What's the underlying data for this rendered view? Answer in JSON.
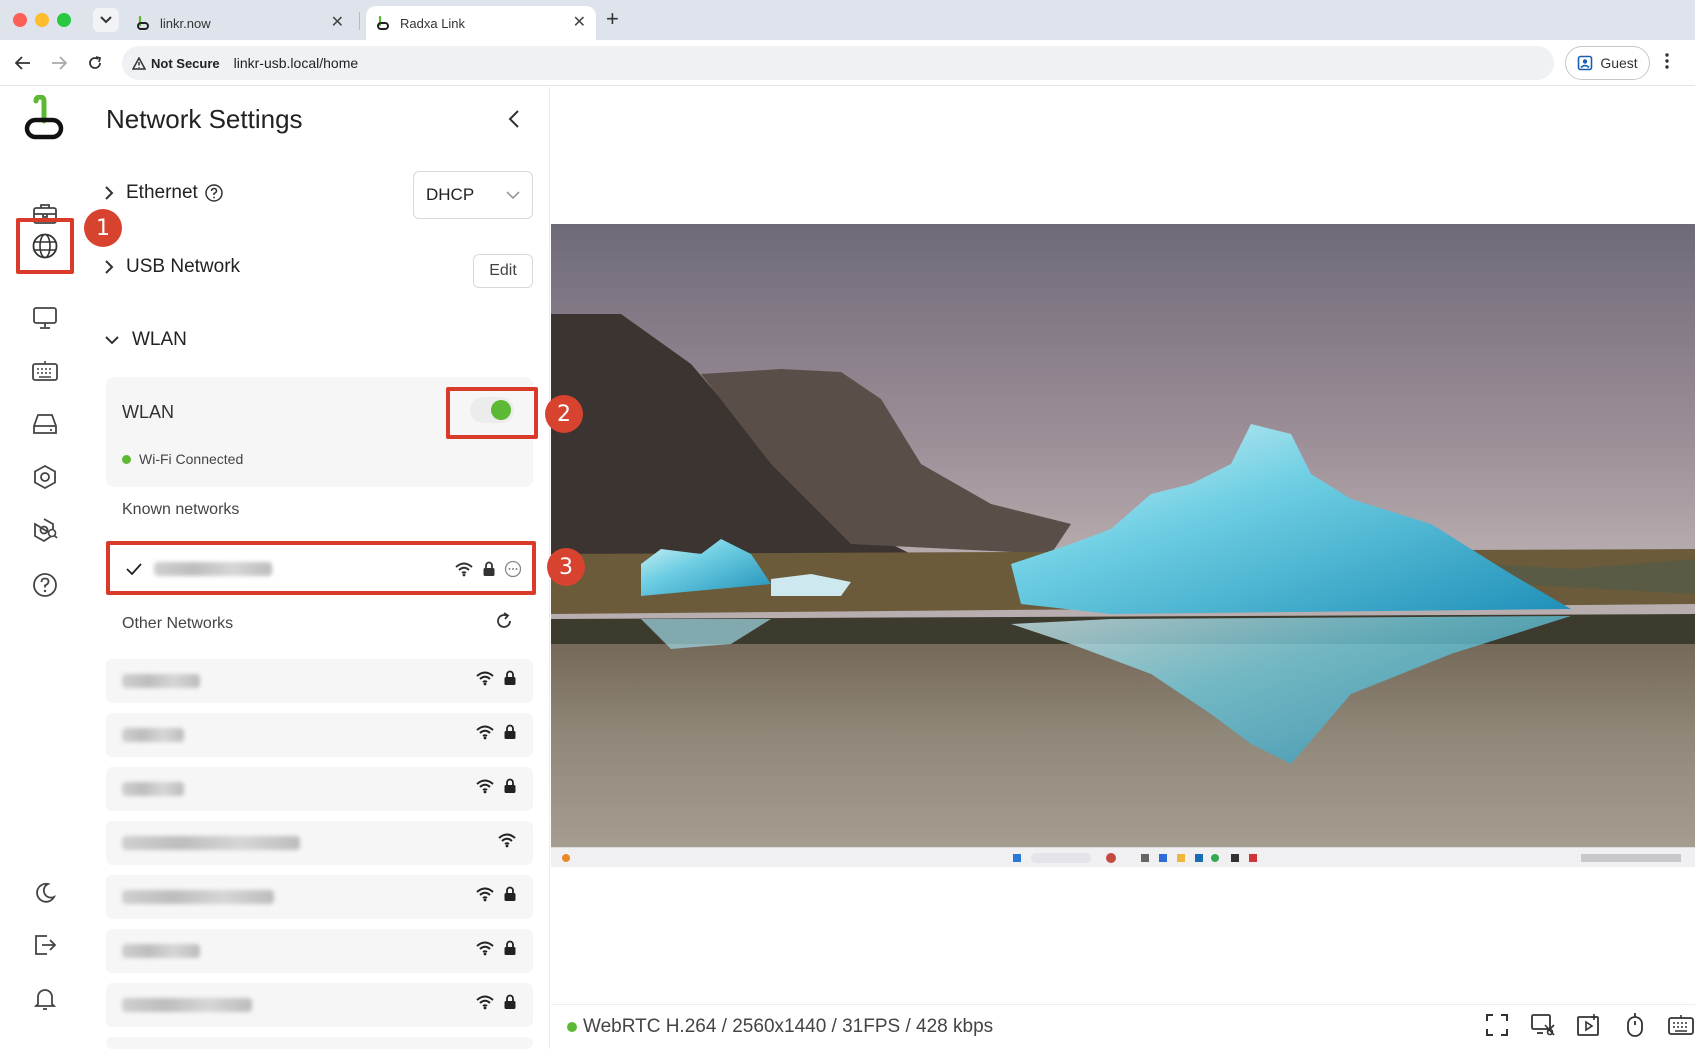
{
  "browser": {
    "tabs": [
      {
        "title": "linkr.now"
      },
      {
        "title": "Radxa Link"
      }
    ],
    "security_label": "Not Secure",
    "url": "linkr-usb.local/home",
    "profile_label": "Guest"
  },
  "panel": {
    "title": "Network Settings",
    "ethernet": {
      "label": "Ethernet",
      "mode": "DHCP"
    },
    "usb_network": {
      "label": "USB Network",
      "edit_label": "Edit"
    },
    "wlan": {
      "section_label": "WLAN",
      "card_label": "WLAN",
      "enabled": true,
      "status": "Wi-Fi Connected",
      "known_label": "Known networks",
      "other_label": "Other Networks"
    }
  },
  "annotations": [
    "1",
    "2",
    "3"
  ],
  "stream": {
    "status": "WebRTC H.264 / 2560x1440 / 31FPS / 428 kbps"
  },
  "colors": {
    "accent_green": "#5cb933",
    "annotation_red": "#d93a2a"
  }
}
